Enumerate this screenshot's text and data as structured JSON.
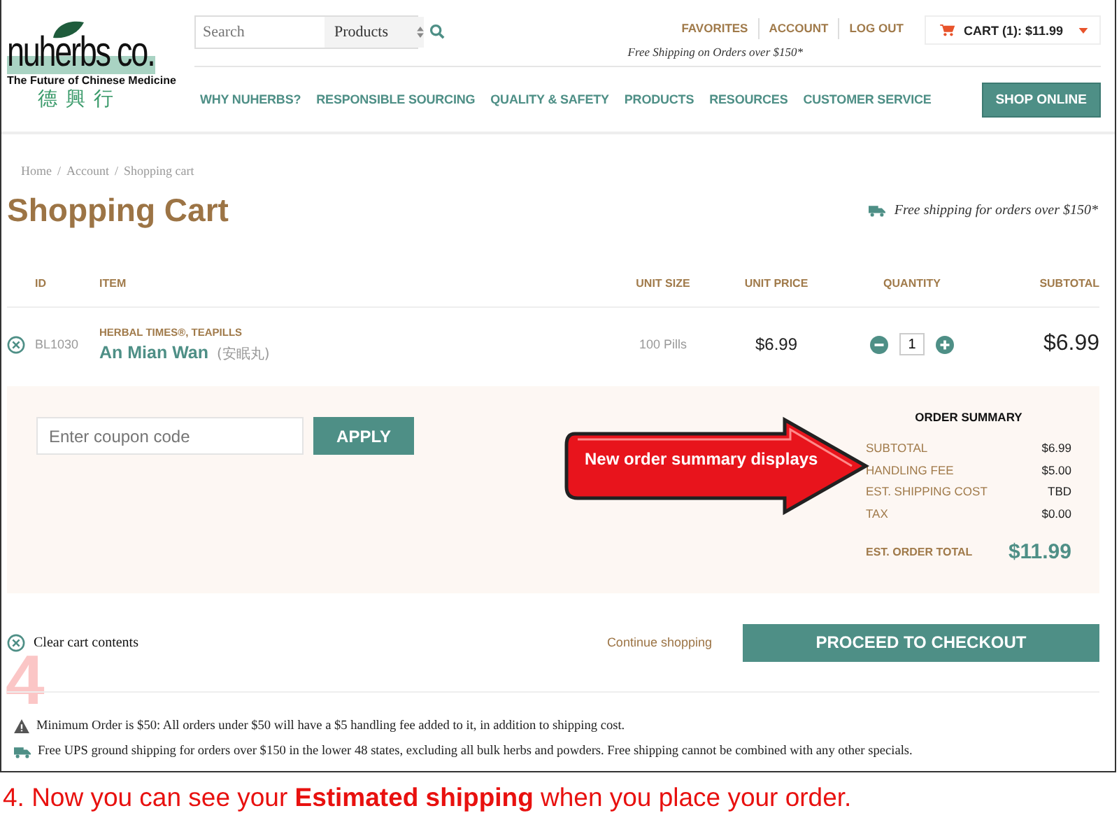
{
  "header": {
    "logo": {
      "name": "nuherbs co.",
      "tagline": "The Future of Chinese Medicine",
      "chinese_name": "德興行"
    },
    "search": {
      "placeholder": "Search",
      "category": "Products"
    },
    "utility_links": [
      "FAVORITES",
      "ACCOUNT",
      "LOG OUT"
    ],
    "cart": "CART (1): $11.99",
    "shipping_note": "Free Shipping on Orders over $150*",
    "nav": [
      "WHY NUHERBS?",
      "RESPONSIBLE SOURCING",
      "QUALITY & SAFETY",
      "PRODUCTS",
      "RESOURCES",
      "CUSTOMER SERVICE"
    ],
    "shop_button": "SHOP ONLINE"
  },
  "breadcrumb": {
    "separator": "/",
    "items": [
      "Home",
      "Account",
      "Shopping cart"
    ]
  },
  "page_title": "Shopping Cart",
  "shipping_banner": "Free shipping for orders over $150*",
  "cart_table": {
    "columns": [
      "ID",
      "ITEM",
      "UNIT SIZE",
      "UNIT PRICE",
      "QUANTITY",
      "SUBTOTAL"
    ],
    "rows": [
      {
        "id": "BL1030",
        "brand": "HERBAL TIMES®, TEAPILLS",
        "name": "An Mian Wan",
        "chinese_name": "(安眠丸)",
        "unit_size": "100 Pills",
        "unit_price": "$6.99",
        "quantity": "1",
        "subtotal": "$6.99"
      }
    ]
  },
  "coupon": {
    "placeholder": "Enter coupon code",
    "button": "APPLY"
  },
  "order_summary": {
    "title": "ORDER SUMMARY",
    "lines": [
      {
        "label": "SUBTOTAL",
        "value": "$6.99"
      },
      {
        "label": "HANDLING FEE",
        "value": "$5.00"
      },
      {
        "label": "EST. SHIPPING COST",
        "value": "TBD"
      },
      {
        "label": "TAX",
        "value": "$0.00"
      }
    ],
    "total": {
      "label": "EST. ORDER TOTAL",
      "value": "$11.99"
    }
  },
  "actions": {
    "clear_cart": "Clear cart contents",
    "continue": "Continue shopping",
    "checkout": "PROCEED TO CHECKOUT"
  },
  "notes": [
    {
      "kind": "warning",
      "text": "Minimum Order is $50: All orders under $50 will have a $5 handling fee added to it, in addition to shipping cost."
    },
    {
      "kind": "shipping",
      "text": "Free UPS ground shipping for orders over $150 in the lower 48 states, excluding all bulk herbs and powders. Free shipping cannot be combined with any other specials."
    }
  ],
  "annotation": {
    "step_number": "4",
    "callout": "New order summary displays",
    "caption": "4. Now you can see your **Estimated shipping** when you place your order."
  }
}
